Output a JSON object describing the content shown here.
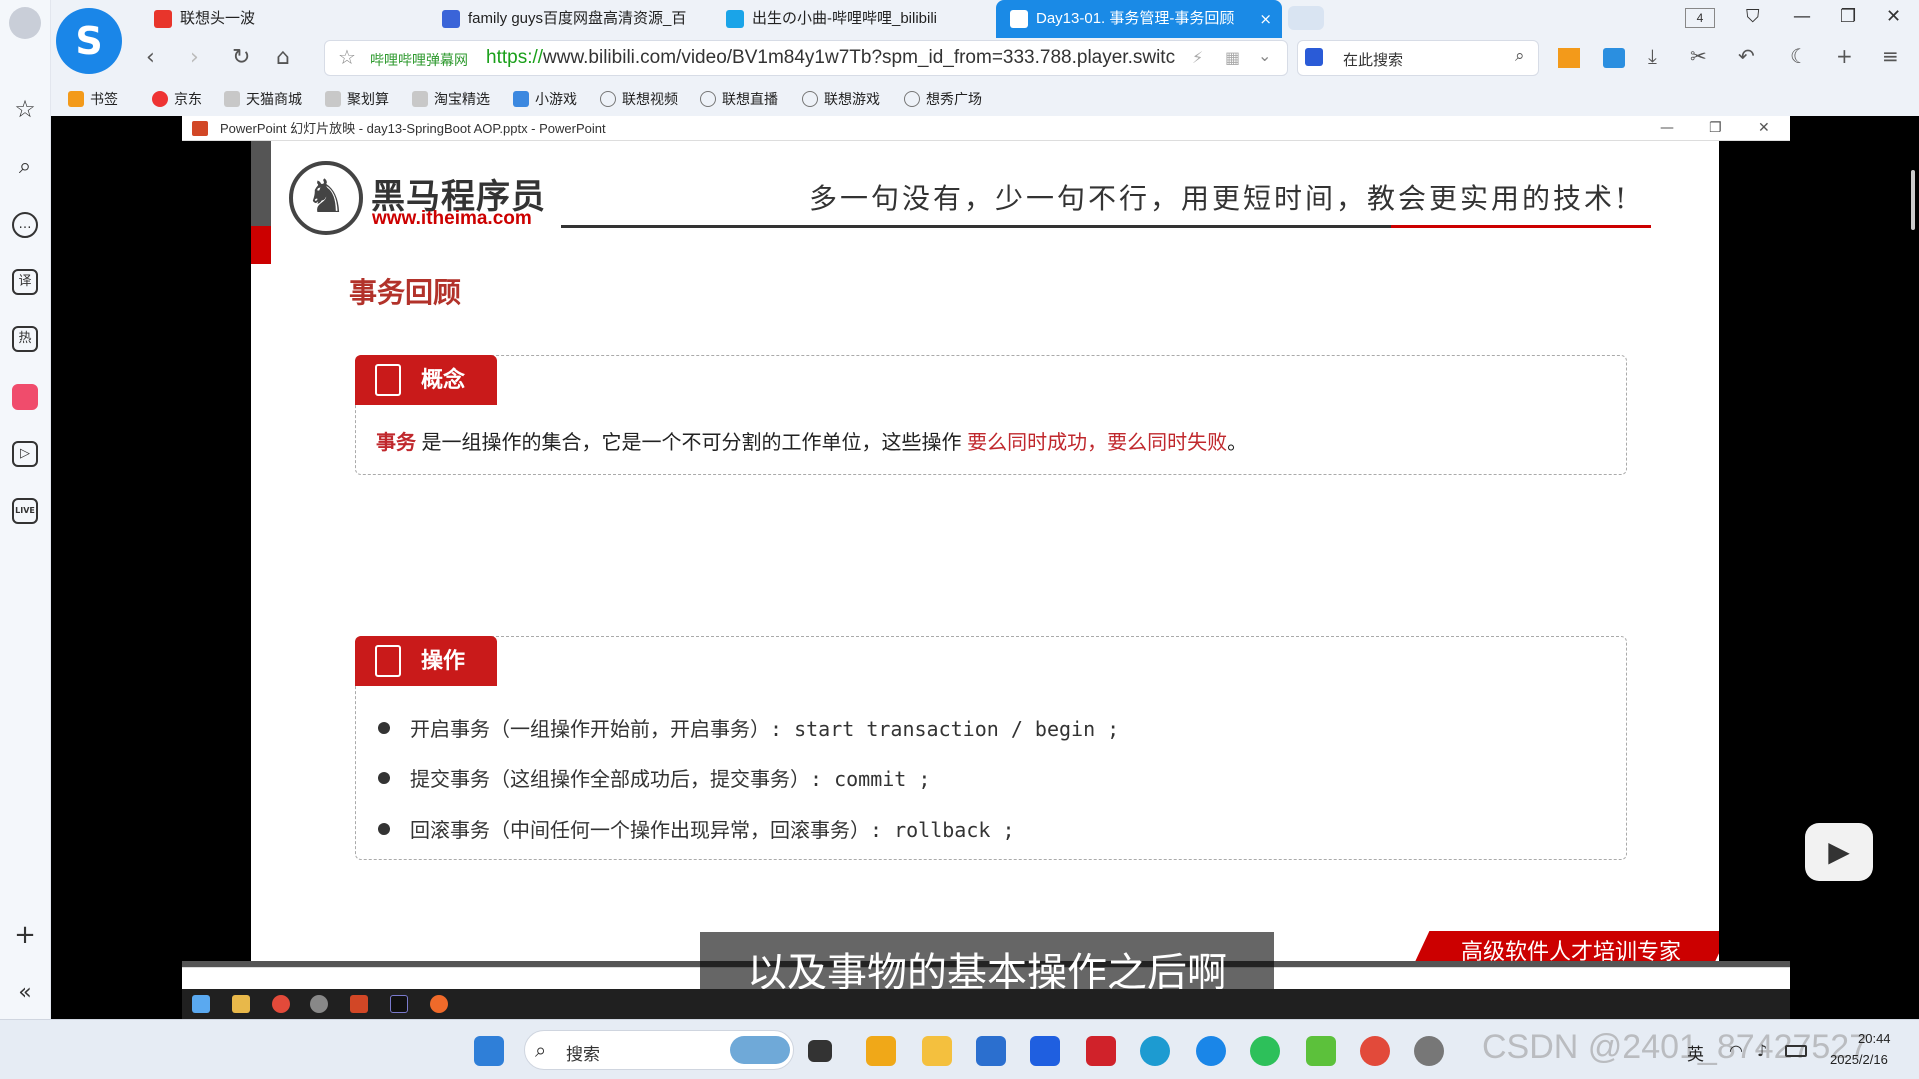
{
  "browser": {
    "tabs": [
      {
        "label": "联想头一波",
        "icon_color": "#e8352b"
      },
      {
        "label": "family guys百度网盘高清资源_百",
        "icon_color": "#3a64d8"
      },
      {
        "label": "出生の小曲-哔哩哔哩_bilibili",
        "icon_color": "#1aa4e8"
      },
      {
        "label": "Day13-01. 事务管理-事务回顾",
        "icon_color": "#ffffff"
      }
    ],
    "tab_counter": "4",
    "site_name": "哔哩哔哩弹幕网",
    "url_protocol": "https://",
    "url_rest": "www.bilibili.com/video/BV1m84y1w7Tb?spm_id_from=333.788.player.switc",
    "search_placeholder": "在此搜索",
    "bookmarks": [
      "书签",
      "京东",
      "天猫商城",
      "聚划算",
      "淘宝精选",
      "小游戏",
      "联想视频",
      "联想直播",
      "联想游戏",
      "想秀广场"
    ]
  },
  "rail": {
    "icons": [
      "star-icon",
      "search-icon",
      "chat-icon",
      "translate-icon",
      "hot-icon",
      "shop-icon",
      "video-icon",
      "live-icon"
    ],
    "translate": "译",
    "hot": "热",
    "live": "LIVE"
  },
  "ppt": {
    "window_title": "PowerPoint 幻灯片放映 - day13-SpringBoot AOP.pptx - PowerPoint"
  },
  "slide": {
    "logo_name": "黑马程序员",
    "logo_url": "www.itheima.com",
    "slogan": "多一句没有，少一句不行，用更短时间，教会更实用的技术!",
    "title": "事务回顾",
    "concept_tag": "概念",
    "concept_term": "事务",
    "concept_text": " 是一组操作的集合，它是一个不可分割的工作单位，这些操作 ",
    "concept_highlight": "要么同时成功，要么同时失败",
    "concept_end": "。",
    "ops_tag": "操作",
    "ops": [
      "开启事务（一组操作开始前，开启事务）: start transaction / begin ;",
      "提交事务（这组操作全部成功后，提交事务）: commit ;",
      "回滚事务（中间任何一个操作出现异常，回滚事务）: rollback ;"
    ],
    "footer": "高级软件人才培训专家"
  },
  "player": {
    "subtitle": "以及事物的基本操作之后啊"
  },
  "taskbar": {
    "search_label": "搜索",
    "ime": "英",
    "time": "20:44",
    "date": "2025/2/16",
    "watermark": "CSDN @2401_87427527"
  }
}
